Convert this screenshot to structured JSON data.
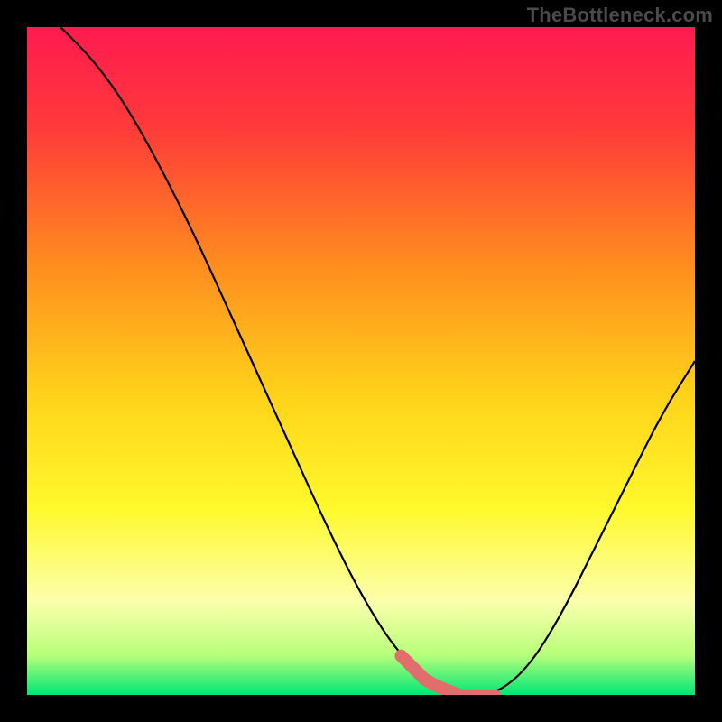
{
  "watermark": "TheBottleneck.com",
  "chart_data": {
    "type": "line",
    "title": "",
    "xlabel": "",
    "ylabel": "",
    "xlim": [
      0,
      100
    ],
    "ylim": [
      0,
      100
    ],
    "grid": false,
    "legend": false,
    "gradient_stops": [
      {
        "offset": 0,
        "color": "#ff1a4f"
      },
      {
        "offset": 15,
        "color": "#ff3a3a"
      },
      {
        "offset": 35,
        "color": "#ff8a1f"
      },
      {
        "offset": 55,
        "color": "#ffd21a"
      },
      {
        "offset": 72,
        "color": "#fff92b"
      },
      {
        "offset": 86,
        "color": "#fbffad"
      },
      {
        "offset": 94,
        "color": "#b8ff7a"
      },
      {
        "offset": 100,
        "color": "#00e676"
      }
    ],
    "series": [
      {
        "name": "bottleneck-curve",
        "color": "#000000",
        "x": [
          5,
          10,
          15,
          20,
          25,
          30,
          35,
          40,
          45,
          50,
          55,
          60,
          65,
          70,
          75,
          80,
          85,
          90,
          95,
          100
        ],
        "y": [
          100,
          95,
          88,
          79,
          69,
          58,
          47,
          36,
          25,
          15,
          7,
          2,
          0,
          0,
          4,
          12,
          22,
          32,
          42,
          50
        ]
      }
    ],
    "highlight": {
      "name": "sweet-spot",
      "color": "#e26d6d",
      "x_range": [
        56,
        70
      ],
      "y": 0
    }
  }
}
